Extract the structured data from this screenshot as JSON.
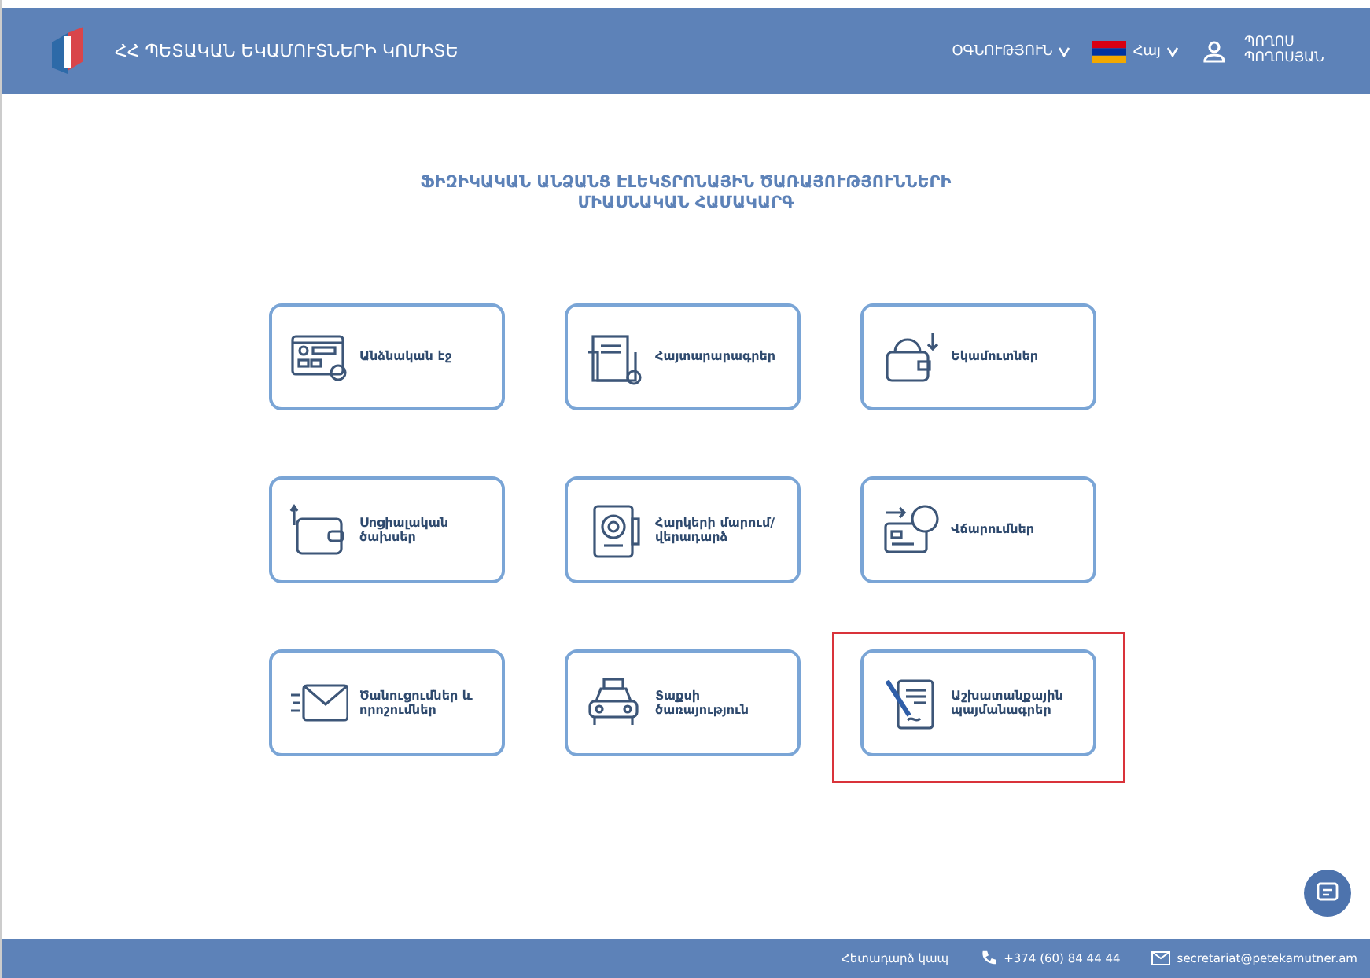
{
  "header": {
    "org_name": "ՀՀ ՊԵՏԱԿԱՆ ԵԿԱՄՈՒՏՆԵՐԻ ԿՈՄԻՏԵ",
    "help_menu": "ՕԳՆՈՒԹՅՈՒՆ",
    "language": "Հայ",
    "user_name": "ՊՈՂՈՍ ՊՈՂՈՍՅԱՆ"
  },
  "title": "ՖԻԶԻԿԱԿԱՆ ԱՆՁԱՆՑ ԷԼԵԿՏՐՈՆԱՅԻՆ ԾԱՌԱՅՈՒԹՅՈՒՆՆԵՐԻ ՄԻԱՍՆԱԿԱՆ ՀԱՄԱԿԱՐԳ",
  "tiles": [
    {
      "label": "Անձնական էջ",
      "kind": "profile",
      "highlighted": false
    },
    {
      "label": "Հայտարարագրեր",
      "kind": "declarations",
      "highlighted": false
    },
    {
      "label": "Եկամուտներ",
      "kind": "income",
      "highlighted": false
    },
    {
      "label": "Սոցիալական ծախսեր",
      "kind": "wallet",
      "highlighted": false
    },
    {
      "label": "Հարկերի մարում/վերադարձ",
      "kind": "refund",
      "highlighted": false
    },
    {
      "label": "Վճարումներ",
      "kind": "payments",
      "highlighted": false
    },
    {
      "label": "Ծանուցումներ և որոշումներ",
      "kind": "mail",
      "highlighted": false
    },
    {
      "label": "Տաքսի ծառայություն",
      "kind": "taxi",
      "highlighted": false
    },
    {
      "label": "Աշխատանքային պայմանագրեր",
      "kind": "contract",
      "highlighted": true
    }
  ],
  "footer": {
    "feedback": "Հետադարձ կապ",
    "phone": "+374 (60) 84 44 44",
    "email": "secretariat@petekamutner.am"
  }
}
